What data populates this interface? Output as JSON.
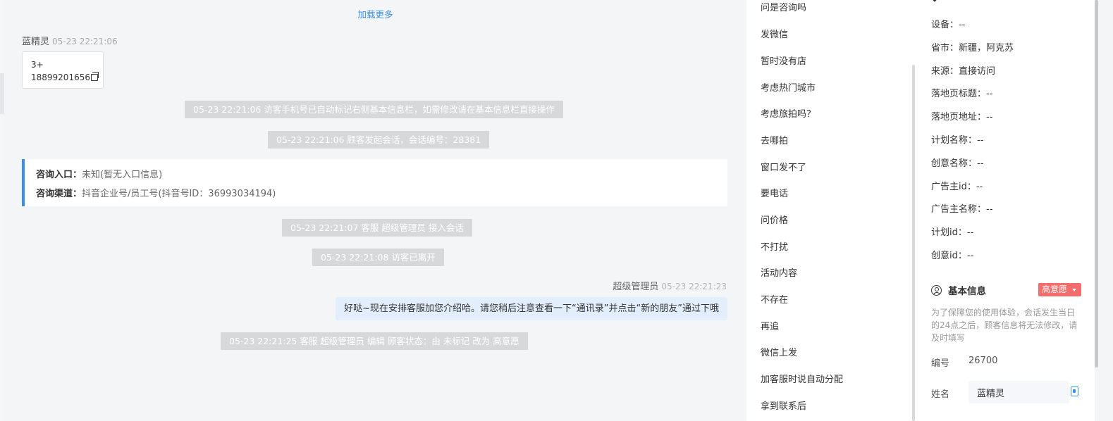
{
  "chat": {
    "load_more": "加载更多",
    "visitor": {
      "name": "蓝精灵",
      "time": "05-23 22:21:06",
      "phone_prefix": "3+",
      "phone": "18899201656"
    },
    "system_messages": [
      "05-23 22:21:06 访客手机号已自动标记右侧基本信息栏，如需修改请在基本信息栏直接操作",
      "05-23 22:21:06 顾客发起会话，会话编号：28381",
      "05-23 22:21:07 客服 超级管理员 接入会话",
      "05-23 22:21:08 访客已离开",
      "05-23 22:21:25 客服 超级管理员 编辑 顾客状态：由 未标记 改为 高意愿"
    ],
    "consult": {
      "entry_label": "咨询入口：",
      "entry_value": "未知(暂无入口信息)",
      "channel_label": "咨询渠道：",
      "channel_value": "抖音企业号/员工号(抖音号ID：36993034194)"
    },
    "agent": {
      "name": "超级管理员",
      "time": "05-23 22:21:23",
      "message": "好哒~现在安排客服加您介绍哈。请您稍后注意查看一下“通讯录”并点击“新的朋友”通过下哦"
    }
  },
  "quick_replies": [
    "问是咨询吗",
    "发微信",
    "暂时没有店",
    "考虑热门城市",
    "考虑旅拍吗？",
    "去哪拍",
    "窗口发不了",
    "要电话",
    "问价格",
    "不打扰",
    "活动内容",
    "不存在",
    "再追",
    "微信上发",
    "加客服时说自动分配",
    "拿到联系后"
  ],
  "info": {
    "rows": [
      {
        "label": "设备：",
        "value": "--"
      },
      {
        "label": "省市：",
        "value": "新疆，阿克苏"
      },
      {
        "label": "来源：",
        "value": "直接访问"
      },
      {
        "label": "落地页标题：",
        "value": "--"
      },
      {
        "label": "落地页地址：",
        "value": "--"
      },
      {
        "label": "计划名称：",
        "value": "--"
      },
      {
        "label": "创意名称：",
        "value": "--"
      },
      {
        "label": "广告主id：",
        "value": "--"
      },
      {
        "label": "广告主名称：",
        "value": "--"
      },
      {
        "label": "计划id：",
        "value": "--"
      },
      {
        "label": "创意id：",
        "value": "--"
      }
    ],
    "basic_title": "基本信息",
    "intent_badge": "高意愿",
    "notice": "为了保障您的使用体验，会话发生当日的24点之后，顾客信息将无法修改，请及时填写",
    "id_label": "编号",
    "id_value": "26700",
    "name_label": "姓名",
    "name_value": "蓝精灵"
  },
  "colors": {
    "accent": "#3a8ee6",
    "badge": "#f56c6c",
    "agent_bubble": "#e3eefc",
    "system_bg": "#d7d8da"
  }
}
